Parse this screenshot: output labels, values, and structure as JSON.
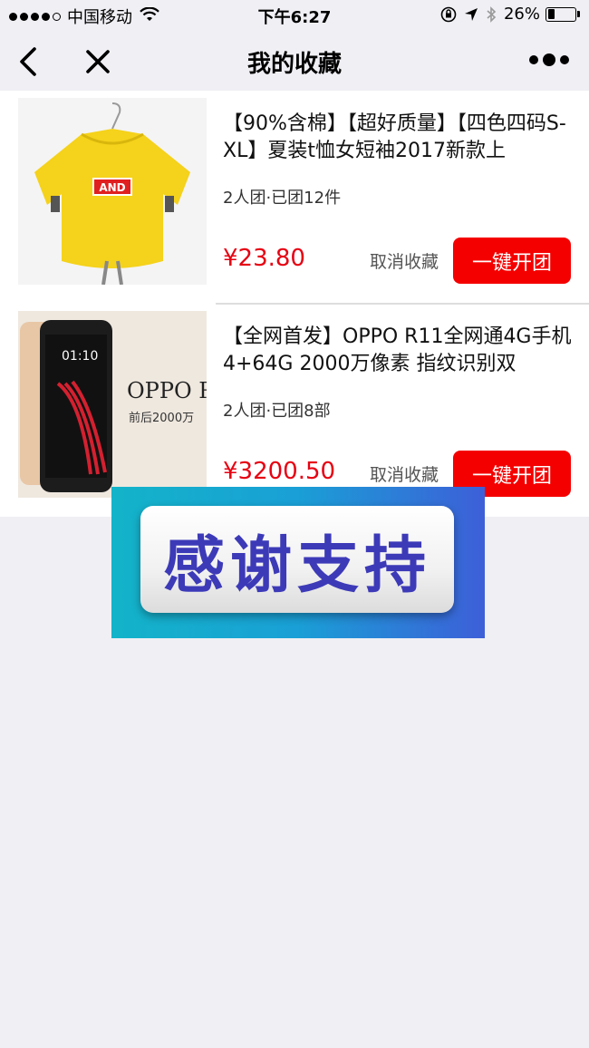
{
  "status_bar": {
    "carrier": "中国移动",
    "time": "下午6:27",
    "battery": "26%",
    "battery_level": 0.26
  },
  "nav": {
    "title": "我的收藏",
    "back_icon": "chevron-left-icon",
    "close_icon": "close-icon",
    "more_icon": "more-dots-icon"
  },
  "favorites": [
    {
      "title": "【90%含棉】【超好质量】【四色四码S-XL】夏装t恤女短袖2017新款上",
      "meta": "2人团·已团12件",
      "price": "¥23.80",
      "unfav_label": "取消收藏",
      "open_label": "一键开团",
      "image_label": "AND"
    },
    {
      "title": "【全网首发】OPPO R11全网通4G手机 4+64G 2000万像素 指纹识别双",
      "meta": "2人团·已团8部",
      "price": "¥3200.50",
      "unfav_label": "取消收藏",
      "open_label": "一键开团",
      "image_brand": "OPPO R",
      "image_caption": "前后2000万",
      "image_clock": "01:10"
    }
  ],
  "banner": {
    "text": "感谢支持"
  },
  "colors": {
    "accent_red": "#f50000",
    "price_red": "#e60012",
    "background": "#efeff4"
  }
}
